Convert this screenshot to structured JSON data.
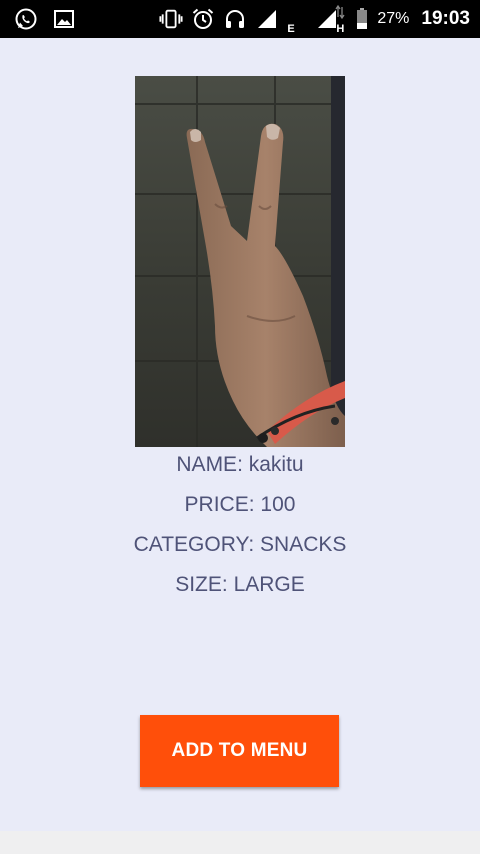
{
  "status_bar": {
    "left_icons": [
      "whatsapp-icon",
      "gallery-icon"
    ],
    "right_icons": [
      "vibrate-icon",
      "alarm-icon",
      "headset-icon",
      "signal-icon",
      "signal-e-icon",
      "signal-h-icon",
      "battery-icon"
    ],
    "network_e": "E",
    "network_h": "H",
    "battery_percent": "27%",
    "time": "19:03"
  },
  "product": {
    "name_line": "NAME: kakitu",
    "price_line": "PRICE: 100",
    "category_line": "CATEGORY: SNACKS",
    "size_line": "SIZE: LARGE"
  },
  "actions": {
    "add_label": "ADD TO MENU"
  },
  "colors": {
    "background": "#e9ebf8",
    "text": "#4f5378",
    "button": "#ff4f0a"
  }
}
